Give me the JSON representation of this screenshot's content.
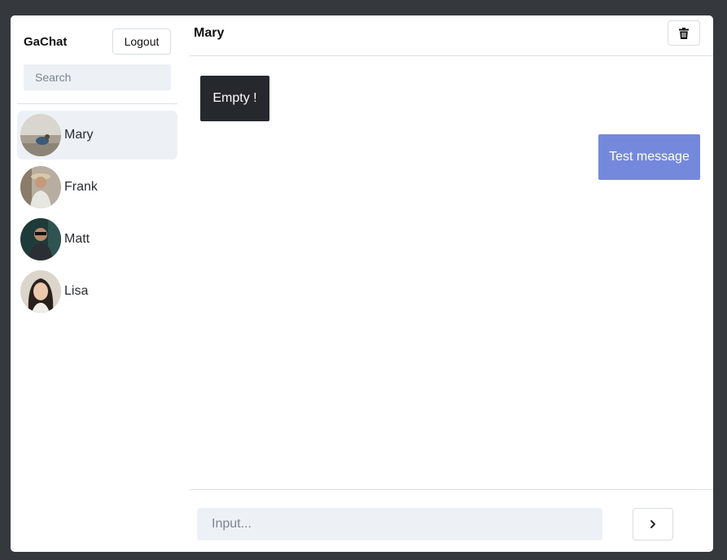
{
  "app": {
    "brand": "GaChat"
  },
  "sidebar": {
    "logout_label": "Logout",
    "search_placeholder": "Search",
    "contacts": [
      {
        "name": "Mary",
        "active": true
      },
      {
        "name": "Frank",
        "active": false
      },
      {
        "name": "Matt",
        "active": false
      },
      {
        "name": "Lisa",
        "active": false
      }
    ]
  },
  "chat": {
    "title": "Mary",
    "messages": [
      {
        "text": "Empty !",
        "direction": "received"
      },
      {
        "text": "Test message",
        "direction": "sent"
      }
    ],
    "input_placeholder": "Input...",
    "send_icon": "chevron-right-icon",
    "delete_icon": "trash-icon"
  },
  "colors": {
    "background": "#35383d",
    "active_contact": "#edf1f5",
    "received_bubble": "#25282d",
    "sent_bubble": "#7589dc"
  }
}
